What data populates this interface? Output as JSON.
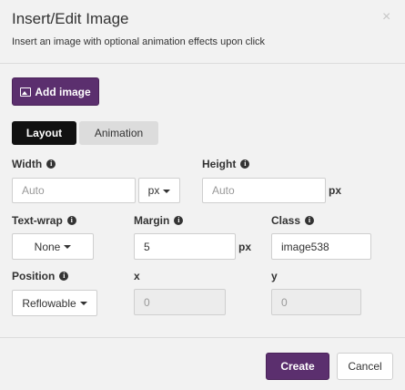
{
  "dialog": {
    "title": "Insert/Edit Image",
    "subtitle": "Insert an image with optional animation effects upon click",
    "close_label": "×"
  },
  "toolbar": {
    "add_image_label": "Add image"
  },
  "tabs": [
    {
      "label": "Layout",
      "active": true
    },
    {
      "label": "Animation",
      "active": false
    }
  ],
  "fields": {
    "width": {
      "label": "Width",
      "placeholder": "Auto",
      "value": ""
    },
    "width_unit": {
      "selected": "px"
    },
    "height": {
      "label": "Height",
      "placeholder": "Auto",
      "value": "",
      "unit": "px"
    },
    "text_wrap": {
      "label": "Text-wrap",
      "selected": "None"
    },
    "margin": {
      "label": "Margin",
      "value": "5",
      "unit": "px"
    },
    "class": {
      "label": "Class",
      "value": "image538"
    },
    "position": {
      "label": "Position",
      "selected": "Reflowable"
    },
    "x": {
      "label": "x",
      "placeholder": "0"
    },
    "y": {
      "label": "y",
      "placeholder": "0"
    }
  },
  "info_glyph": "i",
  "footer": {
    "create_label": "Create",
    "cancel_label": "Cancel"
  },
  "colors": {
    "primary": "#5b2f6e",
    "tab_active": "#111111",
    "tab_inactive": "#dcdcdc",
    "background": "#f2f2f2"
  },
  "icons": {
    "close": "close-icon",
    "add_image": "image-icon",
    "info": "info-icon",
    "caret": "caret-down-icon"
  }
}
